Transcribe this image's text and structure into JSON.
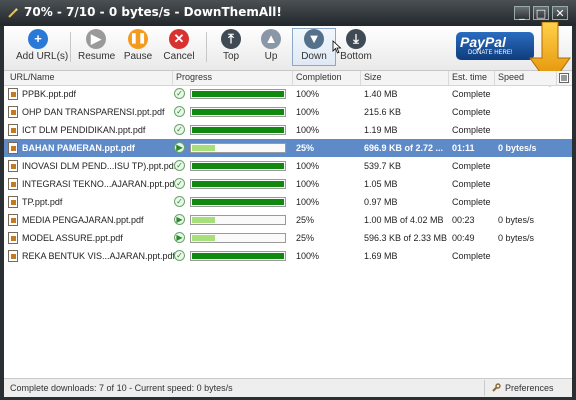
{
  "window": {
    "title": "70% - 7/10 - 0 bytes/s - DownThemAll!",
    "controls": {
      "minimize": "_",
      "maximize": "□",
      "close": "✕"
    }
  },
  "toolbar": {
    "add_urls": "Add URL(s)",
    "resume": "Resume",
    "pause": "Pause",
    "cancel": "Cancel",
    "top": "Top",
    "up": "Up",
    "down": "Down",
    "bottom": "Bottom"
  },
  "paypal": {
    "brand": "PayPal",
    "tagline": "DONATE HERE!"
  },
  "columns": {
    "url": "URL/Name",
    "progress": "Progress",
    "completion": "Completion",
    "size": "Size",
    "est_time": "Est. time",
    "speed": "Speed"
  },
  "downloads": [
    {
      "name": "PPBK.ppt.pdf",
      "progress": 100,
      "completion": "100%",
      "size": "1.40 MB",
      "est_time": "Complete",
      "speed": ""
    },
    {
      "name": "OHP DAN TRANSPARENSI.ppt.pdf",
      "progress": 100,
      "completion": "100%",
      "size": "215.6 KB",
      "est_time": "Complete",
      "speed": ""
    },
    {
      "name": "ICT DLM PENDIDIKAN.ppt.pdf",
      "progress": 100,
      "completion": "100%",
      "size": "1.19 MB",
      "est_time": "Complete",
      "speed": ""
    },
    {
      "name": "BAHAN PAMERAN.ppt.pdf",
      "progress": 25,
      "completion": "25%",
      "size": "696.9 KB of 2.72 ...",
      "est_time": "01:11",
      "speed": "0 bytes/s",
      "selected": true
    },
    {
      "name": "INOVASI DLM PEND...ISU TP).ppt.pdf",
      "progress": 100,
      "completion": "100%",
      "size": "539.7 KB",
      "est_time": "Complete",
      "speed": ""
    },
    {
      "name": "INTEGRASI TEKNO...AJARAN.ppt.pdf",
      "progress": 100,
      "completion": "100%",
      "size": "1.05 MB",
      "est_time": "Complete",
      "speed": ""
    },
    {
      "name": "TP.ppt.pdf",
      "progress": 100,
      "completion": "100%",
      "size": "0.97 MB",
      "est_time": "Complete",
      "speed": ""
    },
    {
      "name": "MEDIA PENGAJARAN.ppt.pdf",
      "progress": 25,
      "completion": "25%",
      "size": "1.00 MB of 4.02 MB",
      "est_time": "00:23",
      "speed": "0 bytes/s"
    },
    {
      "name": "MODEL ASSURE.ppt.pdf",
      "progress": 25,
      "completion": "25%",
      "size": "596.3 KB of 2.33 MB",
      "est_time": "00:49",
      "speed": "0 bytes/s"
    },
    {
      "name": "REKA BENTUK VIS...AJARAN.ppt.pdf",
      "progress": 100,
      "completion": "100%",
      "size": "1.69 MB",
      "est_time": "Complete",
      "speed": ""
    }
  ],
  "status": {
    "text": "Complete downloads: 7 of 10 - Current speed: 0 bytes/s",
    "preferences": "Preferences"
  },
  "colors": {
    "progress_complete": "#0f8a0f",
    "progress_partial": "#a7df7a",
    "selection": "#5e8ac8"
  }
}
